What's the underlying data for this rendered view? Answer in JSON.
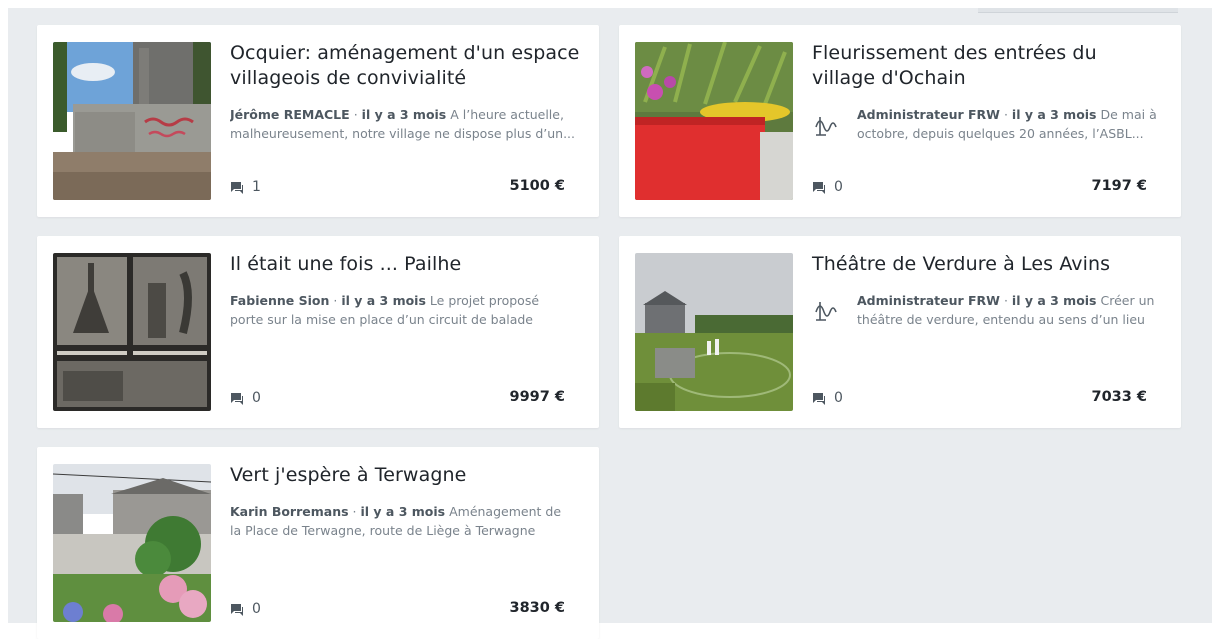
{
  "projects": [
    {
      "title": "Ocquier: aménagement d'un espace villageois de convivialité",
      "author": "Jérôme REMACLE",
      "time": "il y a 3 mois",
      "excerpt": "A l’heure actuelle, malheureusement, notre village ne dispose plus d’un...",
      "comments": "1",
      "amount": "5100 €"
    },
    {
      "title": "Fleurissement des entrées du village d'Ochain",
      "author": "Administrateur FRW",
      "time": "il y a 3 mois",
      "excerpt": "De mai à octobre, depuis quelques 20 années, l’ASBL...",
      "comments": "0",
      "amount": "7197 €",
      "author_icon": "frw-logo-icon"
    },
    {
      "title": "Il était une fois ... Pailhe",
      "author": "Fabienne Sion",
      "time": "il y a 3 mois",
      "excerpt": "Le projet proposé porte sur la mise en place d’un circuit de balade historique d...",
      "comments": "0",
      "amount": "9997 €"
    },
    {
      "title": "Théâtre de Verdure à Les Avins",
      "author": "Administrateur FRW",
      "time": "il y a 3 mois",
      "excerpt": "Créer un théâtre de verdure, entendu au sens d’un lieu d...",
      "comments": "0",
      "amount": "7033 €",
      "author_icon": "frw-logo-icon"
    },
    {
      "title": "Vert j'espère à Terwagne",
      "author": "Karin Borremans",
      "time": "il y a 3 mois",
      "excerpt": "Aménagement de la Place de Terwagne, route de Liège à Terwagne (Clavier)",
      "comments": "0",
      "amount": "3830 €"
    }
  ],
  "separator": "·",
  "icons": {
    "comments": "comment-icon"
  },
  "colors": {
    "page_bg": "#e9ecef",
    "card_bg": "#ffffff",
    "author": "#4d5760",
    "muted": "#7a838c"
  }
}
